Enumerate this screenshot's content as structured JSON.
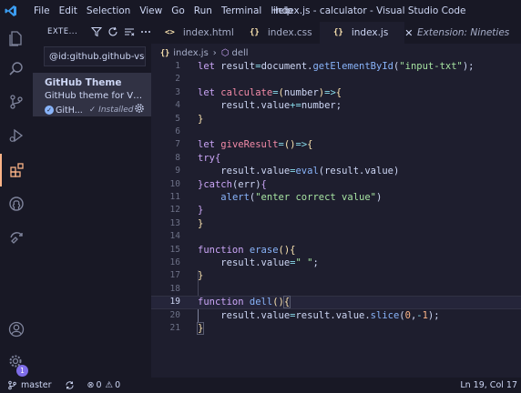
{
  "window": {
    "title": "index.js - calculator - Visual Studio Code"
  },
  "menu": [
    "File",
    "Edit",
    "Selection",
    "View",
    "Go",
    "Run",
    "Terminal",
    "Help"
  ],
  "activity_bar": {
    "items": [
      "explorer-icon",
      "search-icon",
      "source-control-icon",
      "run-debug-icon",
      "extensions-icon",
      "github-icon",
      "remote-icon",
      "account-icon",
      "manage-gear-icon"
    ],
    "badge": "1",
    "accent": "#fab387"
  },
  "sidebar": {
    "title": "EXTE...",
    "search_value": "@id:github.github-vsco",
    "extension": {
      "name": "GitHub Theme",
      "description": "GitHub theme for VS C...",
      "publisher": "GitH...",
      "status": "Installed"
    }
  },
  "tabs": [
    {
      "icon": "<>",
      "label": "index.html",
      "active": false
    },
    {
      "icon": "{}",
      "label": "index.css",
      "active": false
    },
    {
      "icon": "{}",
      "label": "index.js",
      "active": true
    },
    {
      "icon": "",
      "label": "Extension: Nineties",
      "active": false
    }
  ],
  "breadcrumb": {
    "file": "index.js",
    "symbol": "dell"
  },
  "editor": {
    "current_line": 19,
    "lines": [
      "let result=document.getElementById(\"input-txt\");",
      "",
      "let calculate=(number)=>{",
      "    result.value+=number;",
      "}",
      "",
      "let giveResult=()=>{",
      "try{",
      "    result.value=eval(result.value)",
      "}catch(err){",
      "    alert(\"enter correct value\")",
      "}",
      "}",
      "",
      "function erase(){",
      "    result.value=\" \";",
      "}",
      "",
      "function dell(){",
      "    result.value=result.value.slice(0,-1);",
      "}"
    ]
  },
  "status": {
    "branch": "master",
    "errors": "0",
    "warnings": "0",
    "position": "Ln 19, Col 17"
  }
}
